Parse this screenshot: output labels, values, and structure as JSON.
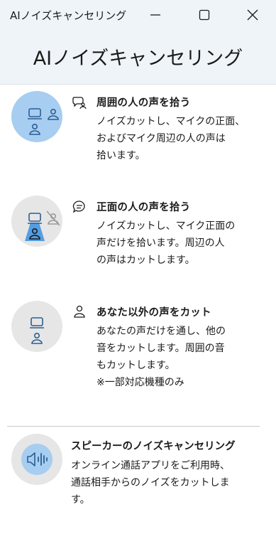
{
  "window": {
    "title": "AIノイズキャンセリング",
    "minimize_icon": "minimize-icon",
    "maximize_icon": "maximize-icon",
    "close_icon": "close-icon"
  },
  "header": {
    "title": "AIノイズキャンセリング"
  },
  "options": [
    {
      "title": "周囲の人の声を拾う",
      "description": "ノイズカットし、マイクの正面、\nおよびマイク周辺の人の声は\n拾います。",
      "icon": "group-chat-icon",
      "illustration": "room-mode-illustration",
      "selected": true
    },
    {
      "title": "正面の人の声を拾う",
      "description": "ノイズカットし、マイク正面の\n声だけを拾います。周辺の人\nの声はカットします。",
      "icon": "chat-bubble-icon",
      "illustration": "front-mode-illustration",
      "selected": false
    },
    {
      "title": "あなた以外の声をカット",
      "description": "あなたの声だけを通し、他の\n音をカットします。周囲の音\nもカットします。\n※一部対応機種のみ",
      "icon": "person-icon",
      "illustration": "voice-only-illustration",
      "selected": false
    }
  ],
  "speaker": {
    "title": "スピーカーのノイズキャンセリング",
    "description": "オンライン通話アプリをご利用時、\n通話相手からのノイズをカットしま\nす。",
    "illustration": "speaker-illustration"
  },
  "colors": {
    "active_circle": "#a7cdf1",
    "inactive_circle": "#e6e6e6",
    "icon_stroke": "#2b5f92",
    "beam": "#3a8fe0"
  }
}
